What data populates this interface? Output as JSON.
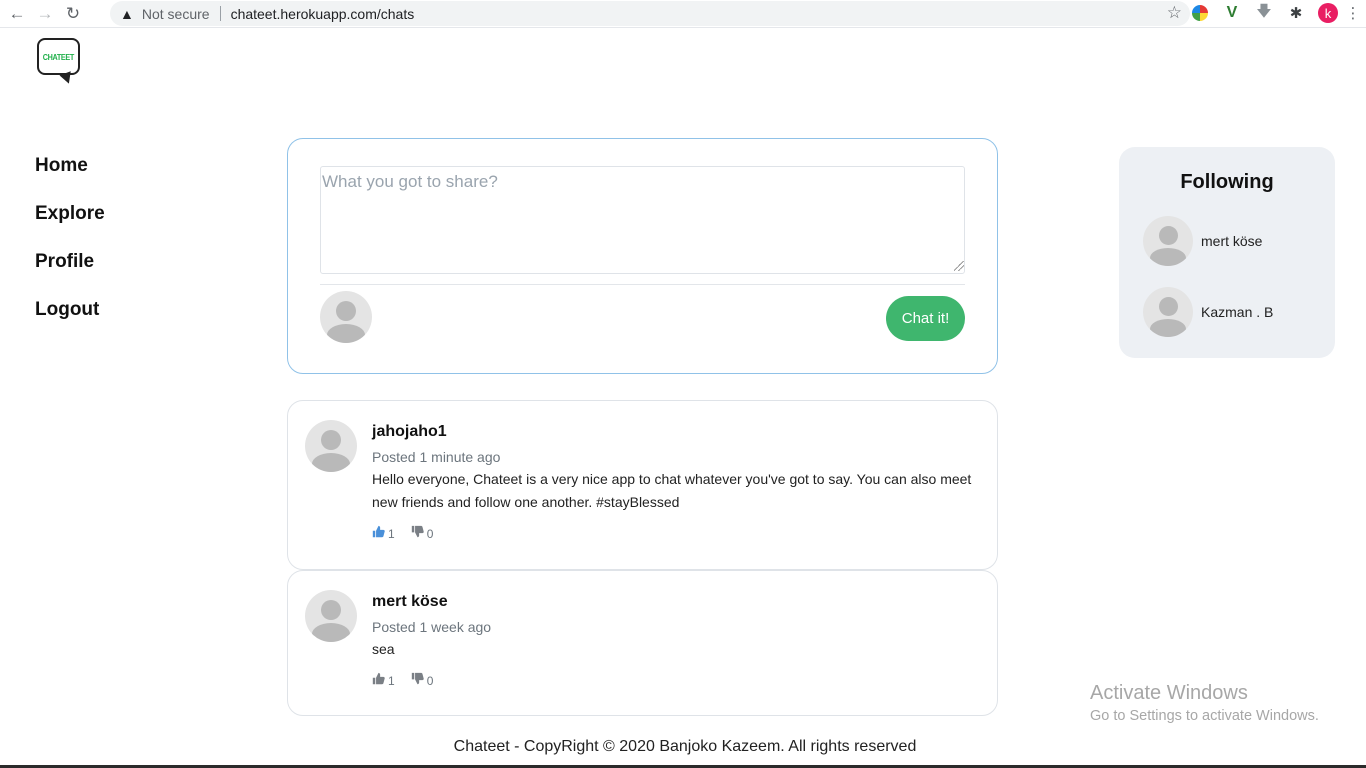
{
  "browser": {
    "security_label": "Not secure",
    "url": "chateet.herokuapp.com/chats",
    "profile_initial": "k",
    "icons": [
      "back-icon",
      "forward-icon",
      "reload-icon",
      "warning-icon",
      "star-icon",
      "color-wheel-icon",
      "vue-devtools-icon",
      "download-icon",
      "puzzle-icon",
      "kebab-menu-icon"
    ]
  },
  "logo": {
    "text": "CHATEET"
  },
  "nav": {
    "items": [
      {
        "label": "Home"
      },
      {
        "label": "Explore"
      },
      {
        "label": "Profile"
      },
      {
        "label": "Logout"
      }
    ]
  },
  "composer": {
    "placeholder": "What you got to share?",
    "submit_label": "Chat it!"
  },
  "posts": [
    {
      "author": "jahojaho1",
      "time": "Posted 1 minute ago",
      "text": "Hello everyone, Chateet is a very nice app to chat whatever you've got to say. You can also meet new friends and follow one another. #stayBlessed",
      "likes": "1",
      "dislikes": "0",
      "liked": true
    },
    {
      "author": "mert köse",
      "time": "Posted 1 week ago",
      "text": "sea",
      "likes": "1",
      "dislikes": "0",
      "liked": false
    }
  ],
  "following": {
    "title": "Following",
    "users": [
      {
        "name": "mert köse"
      },
      {
        "name": "Kazman . B"
      }
    ]
  },
  "watermark": {
    "title": "Activate Windows",
    "subtitle": "Go to Settings to activate Windows."
  },
  "footer": {
    "text": "Chateet - CopyRight © 2020 Banjoko Kazeem. All rights reserved"
  },
  "colors": {
    "accent_green": "#3fb66e",
    "composer_border": "#90c2e8",
    "like_active": "#4a90d9",
    "panel_bg": "#edf0f4"
  }
}
